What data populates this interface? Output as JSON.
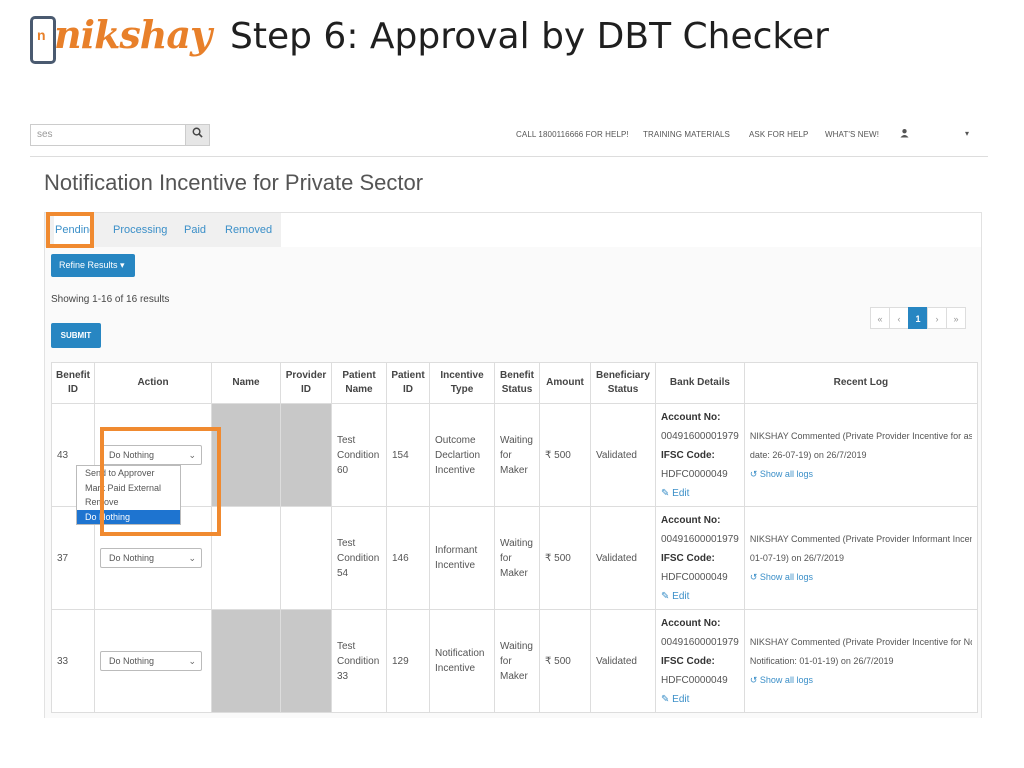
{
  "slide": {
    "logo_text": "nikshay",
    "logo_phone_letter": "n",
    "title": "Step 6: Approval by DBT Checker"
  },
  "topbar": {
    "search_placeholder": "ses",
    "search_icon": "search-icon",
    "nav": [
      "CALL 1800116666 FOR HELP!",
      "TRAINING MATERIALS",
      "ASK FOR HELP",
      "WHAT'S NEW!"
    ],
    "user_icon": "user-icon",
    "caret": "▾"
  },
  "page": {
    "title": "Notification Incentive for Private Sector",
    "tabs": [
      "Pending",
      "Processing",
      "Paid",
      "Removed"
    ],
    "active_tab": "Pending",
    "refine_label": "Refine Results",
    "showing": "Showing 1-16 of 16 results",
    "submit_label": "SUBMIT",
    "pager": [
      "«",
      "‹",
      "1",
      "›",
      "»"
    ],
    "current_page": "1"
  },
  "table": {
    "headers": [
      "Benefit ID",
      "Action",
      "Name",
      "Provider ID",
      "Patient Name",
      "Patient ID",
      "Incentive Type",
      "Benefit Status",
      "Amount",
      "Beneficiary Status",
      "Bank Details",
      "Recent Log"
    ],
    "rows": [
      {
        "benefit_id": "43",
        "action": "Do Nothing",
        "patient_name": "Test Condition 60",
        "patient_id": "154",
        "incentive_type": "Outcome Declartion Incentive",
        "benefit_status": "Waiting for Maker",
        "amount": "₹ 500",
        "beneficiary_status": "Validated",
        "account_label": "Account No:",
        "account_no": "00491600001979",
        "ifsc_label": "IFSC Code:",
        "ifsc": "HDFC0000049",
        "edit": "Edit",
        "log_line1": "NIKSHAY Commented (Private Provider Incentive for assi",
        "log_line2": "date: 26-07-19) on 26/7/2019",
        "show_logs": "Show all logs"
      },
      {
        "benefit_id": "37",
        "action": "Do Nothing",
        "patient_name": "Test Condition 54",
        "patient_id": "146",
        "incentive_type": "Informant Incentive",
        "benefit_status": "Waiting for Maker",
        "amount": "₹ 500",
        "beneficiary_status": "Validated",
        "account_label": "Account No:",
        "account_no": "00491600001979",
        "ifsc_label": "IFSC Code:",
        "ifsc": "HDFC0000049",
        "edit": "Edit",
        "log_line1": "NIKSHAY Commented (Private Provider Informant Incenti",
        "log_line2": "01-07-19) on 26/7/2019",
        "show_logs": "Show all logs"
      },
      {
        "benefit_id": "33",
        "action": "Do Nothing",
        "patient_name": "Test Condition 33",
        "patient_id": "129",
        "incentive_type": "Notification Incentive",
        "benefit_status": "Waiting for Maker",
        "amount": "₹ 500",
        "beneficiary_status": "Validated",
        "account_label": "Account No:",
        "account_no": "00491600001979",
        "ifsc_label": "IFSC Code:",
        "ifsc": "HDFC0000049",
        "edit": "Edit",
        "log_line1": "NIKSHAY Commented (Private Provider Incentive for Not",
        "log_line2": "Notification: 01-01-19) on 26/7/2019",
        "show_logs": "Show all logs"
      }
    ]
  },
  "dropdown": {
    "options": [
      "Send to Approver",
      "Mark Paid External",
      "Remove",
      "Do Nothing"
    ],
    "selected": "Do Nothing"
  },
  "colors": {
    "accent": "#2786c2",
    "highlight": "#f08a30",
    "logo": "#e8802a"
  }
}
